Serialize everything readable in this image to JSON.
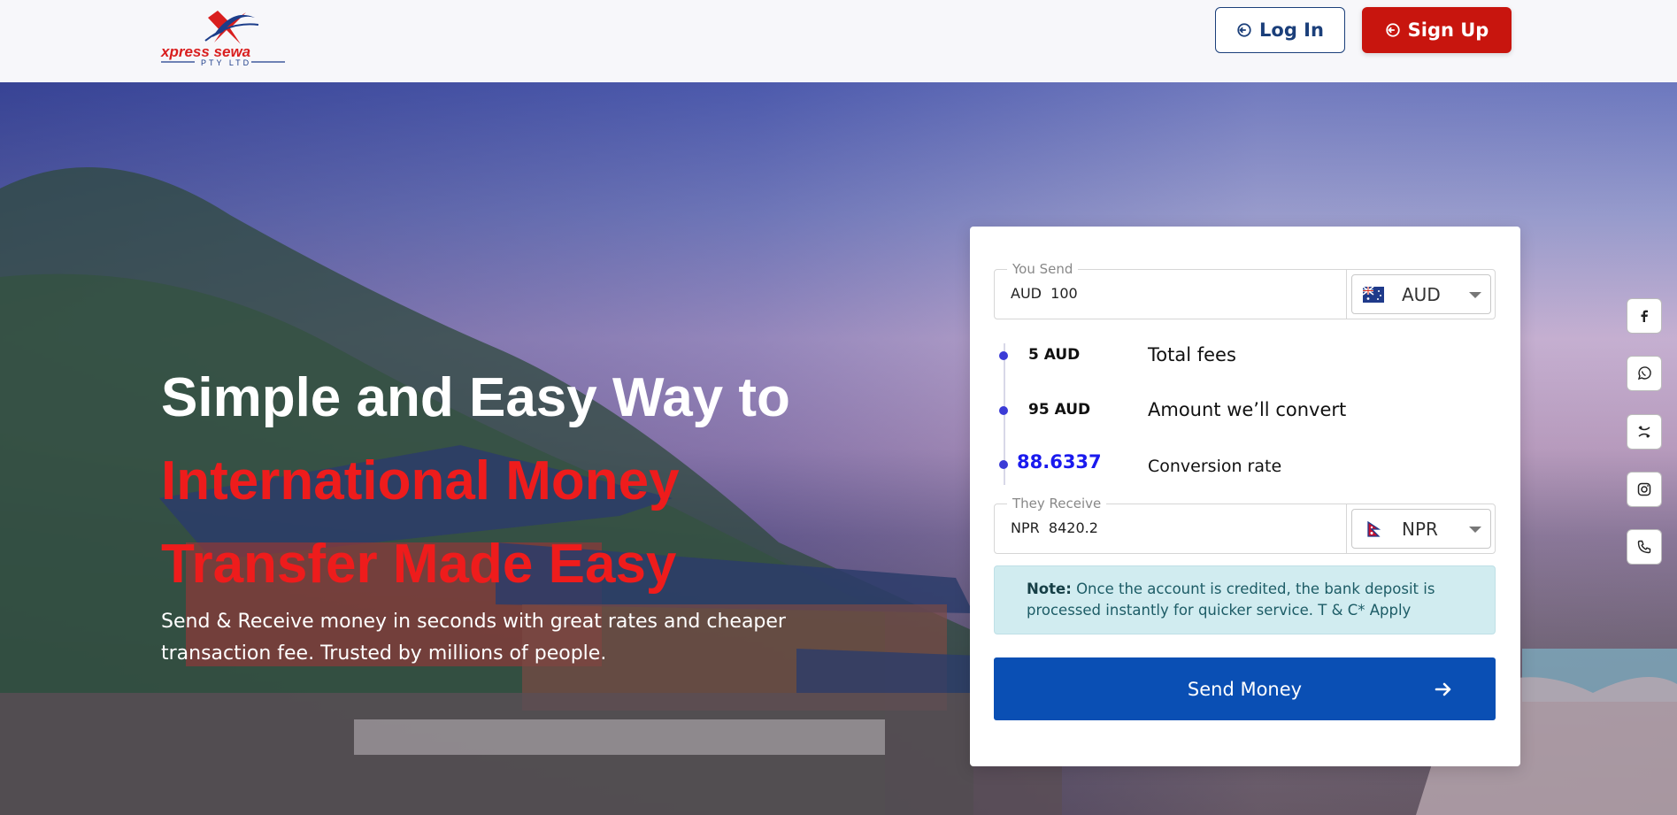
{
  "header": {
    "logo_text": "xpress sewa",
    "logo_sub": "PTY LTD",
    "login_label": "Log In",
    "signup_label": "Sign Up"
  },
  "hero": {
    "headline_line1": "Simple and Easy Way to",
    "headline_line2": "International Money",
    "headline_line3": "Transfer Made Easy",
    "subtext": "Send & Receive money in seconds with great rates and cheaper transaction fee. Trusted by millions of people."
  },
  "converter": {
    "send": {
      "legend": "You Send",
      "value": "AUD  100",
      "currency": "AUD",
      "flag": "australia-flag"
    },
    "breakdown": [
      {
        "value": "5 AUD",
        "label": "Total fees"
      },
      {
        "value": "95 AUD",
        "label": "Amount we’ll convert"
      },
      {
        "value": "88.6337",
        "label": "Conversion rate"
      }
    ],
    "receive": {
      "legend": "They Receive",
      "value": "NPR  8420.2",
      "currency": "NPR",
      "flag": "nepal-flag"
    },
    "note_bold": "Note:",
    "note_text": " Once the account is credited, the bank deposit is processed instantly for quicker service. T & C* Apply",
    "send_button": "Send Money"
  },
  "social": [
    "facebook-icon",
    "whatsapp-icon",
    "viber-icon",
    "instagram-icon",
    "phone-icon"
  ],
  "colors": {
    "brand_red": "#c8150e",
    "brand_blue": "#0a4fb4",
    "headline_red": "#ee1c1c",
    "rate_blue": "#1a1aee",
    "note_bg": "#d1ecf0"
  }
}
